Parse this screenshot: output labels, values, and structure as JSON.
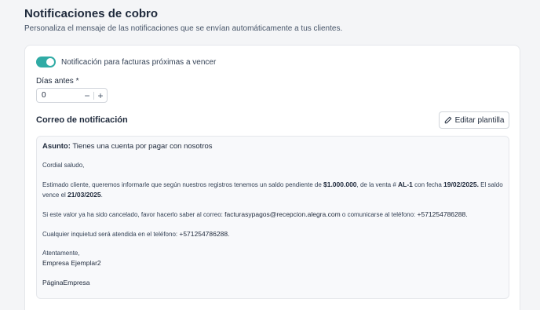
{
  "header": {
    "title": "Notificaciones de cobro",
    "subtitle": "Personaliza el mensaje de las notificaciones que se envían automáticamente a tus clientes."
  },
  "notification": {
    "toggle_label": "Notificación para facturas próximas a vencer",
    "toggle_on": true,
    "days_label": "Días antes *",
    "days_value": "0",
    "minus": "−",
    "plus": "+"
  },
  "email": {
    "section_title": "Correo de notificación",
    "edit_button": "Editar plantilla",
    "subject_label": "Asunto:",
    "subject_text": " Tienes una cuenta por pagar con nosotros",
    "greeting": "Cordial saludo,",
    "p1_a": "Estimado cliente, queremos informarle que según nuestros registros tenemos un saldo pendiente de ",
    "p1_amount": "$1.000.000",
    "p1_b": ", de la venta # ",
    "p1_sale": "AL-1",
    "p1_c": " con fecha ",
    "p1_date": "19/02/2025.",
    "p1_d": "  El saldo",
    "p1_e": "vence el ",
    "p1_due": "21/03/2025",
    "p1_f": ".",
    "p2_a": "Si este valor ya ha sido cancelado, favor hacerlo saber al correo: ",
    "p2_email": "facturasypagos@recepcion.alegra.com",
    "p2_b": " o comunicarse al teléfono: ",
    "p2_phone": "+571254786288.",
    "p3_a": "Cualquier inquietud será atendida en el teléfono: ",
    "p3_phone": "+571254786288.",
    "closing": "Atentamente,",
    "company": "Empresa Ejemplar2",
    "website": "PáginaEmpresa"
  },
  "colors": {
    "toggle": "#30aba5"
  }
}
